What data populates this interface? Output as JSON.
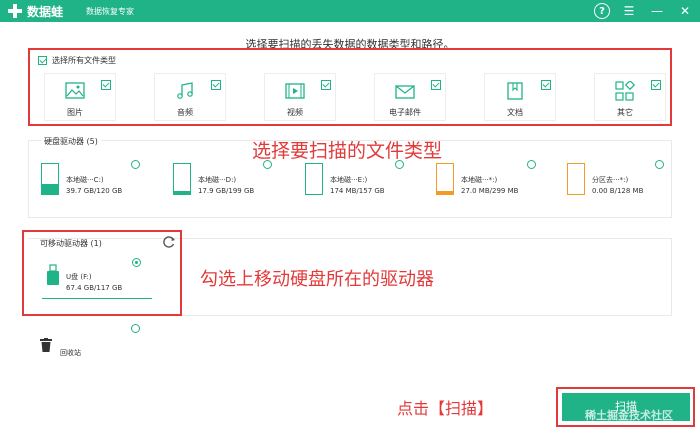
{
  "window": {
    "app_title": "数据蛙",
    "app_subtitle": "数据恢复专家",
    "help_label": "?",
    "menu_label": "☰",
    "minimize_label": "—",
    "close_label": "✕"
  },
  "instruction": "选择要扫描的丢失数据的数据类型和路径。",
  "filetypes": {
    "select_all_label": "选择所有文件类型",
    "items": [
      {
        "label": "图片",
        "icon": "image-icon",
        "checked": true
      },
      {
        "label": "音频",
        "icon": "music-icon",
        "checked": true
      },
      {
        "label": "视频",
        "icon": "video-icon",
        "checked": true
      },
      {
        "label": "电子邮件",
        "icon": "email-icon",
        "checked": true
      },
      {
        "label": "文档",
        "icon": "document-icon",
        "checked": true
      },
      {
        "label": "其它",
        "icon": "other-icon",
        "checked": true
      }
    ]
  },
  "annotations": {
    "filetype_hint": "选择要扫描的文件类型",
    "drive_hint": "勾选上移动硬盘所在的驱动器",
    "scan_hint": "点击【扫描】"
  },
  "hard_drives": {
    "title": "硬盘驱动器 (5)",
    "items": [
      {
        "name": "本地磁···C:)",
        "size": "39.7 GB/120 GB",
        "fill": 0.33,
        "color": "#1fb387"
      },
      {
        "name": "本地磁···D:)",
        "size": "17.9 GB/199 GB",
        "fill": 0.09,
        "color": "#1fb387"
      },
      {
        "name": "本地磁···E:)",
        "size": "174 MB/157 GB",
        "fill": 0.01,
        "color": "#1fb387"
      },
      {
        "name": "本地磁···*:)",
        "size": "27.0 MB/299 MB",
        "fill": 0.09,
        "color": "#f39b26"
      },
      {
        "name": "分区去···*:)",
        "size": "0.00  B/128 MB",
        "fill": 0.0,
        "color": "#f39b26"
      }
    ]
  },
  "removable": {
    "title": "可移动驱动器 (1)",
    "name": "U盘 (F:)",
    "size": "67.4 GB/117 GB",
    "selected": true
  },
  "recycle_label": "回收站",
  "scan_button": "扫描",
  "watermark": "稀土掘金技术社区",
  "colors": {
    "accent": "#1fb387",
    "annotation": "#e23a3a"
  }
}
